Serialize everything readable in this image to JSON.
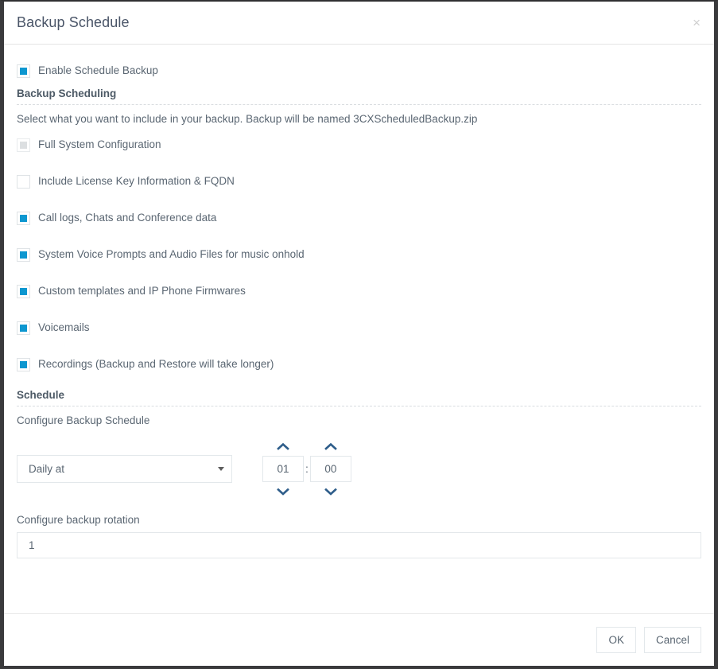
{
  "dialog": {
    "title": "Backup Schedule",
    "close_label": "×"
  },
  "enable": {
    "label": "Enable Schedule Backup",
    "checked": true
  },
  "backup_scheduling": {
    "heading": "Backup Scheduling",
    "description": "Select what you want to include in your backup. Backup will be named 3CXScheduledBackup.zip",
    "options": [
      {
        "label": "Full System Configuration",
        "state": "disabled-checked"
      },
      {
        "label": "Include License Key Information & FQDN",
        "state": "unchecked"
      },
      {
        "label": "Call logs, Chats and Conference data",
        "state": "checked"
      },
      {
        "label": "System Voice Prompts and Audio Files for music onhold",
        "state": "checked"
      },
      {
        "label": "Custom templates and IP Phone Firmwares",
        "state": "checked"
      },
      {
        "label": "Voicemails",
        "state": "checked"
      },
      {
        "label": "Recordings (Backup and Restore will take longer)",
        "state": "checked"
      }
    ]
  },
  "schedule": {
    "heading": "Schedule",
    "configure_label": "Configure Backup Schedule",
    "frequency_value": "Daily at",
    "hour_value": "01",
    "minute_value": "00",
    "time_separator": ":",
    "rotation_label": "Configure backup rotation",
    "rotation_value": "1"
  },
  "footer": {
    "ok_label": "OK",
    "cancel_label": "Cancel"
  },
  "colors": {
    "checkbox_accent": "#0d97d0",
    "chevron": "#2e5d8a",
    "text": "#5a6672",
    "border": "#e3e8eb"
  }
}
